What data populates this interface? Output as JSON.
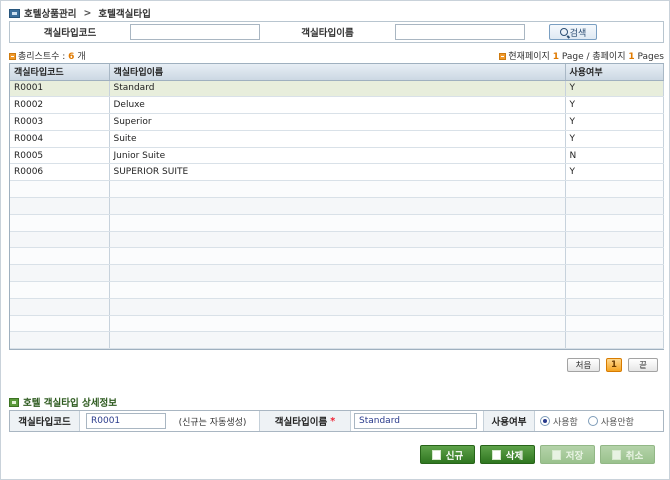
{
  "breadcrumb": {
    "parent": "호텔상품관리",
    "separator": ">",
    "current": "호텔객실타입"
  },
  "search": {
    "code_label": "객실타입코드",
    "code_value": "",
    "name_label": "객실타입이름",
    "name_value": "",
    "button_label": "검색"
  },
  "summary": {
    "total_label": "총리스트수 :",
    "total_count": "6",
    "total_unit": "개",
    "page_prefix": "현재페이지",
    "current_page": "1",
    "page_mid": "Page / 총페이지",
    "total_pages": "1",
    "page_suffix": "Pages"
  },
  "table": {
    "columns": [
      "객실타입코드",
      "객실타입이름",
      "사용여부"
    ],
    "rows": [
      [
        "R0001",
        "Standard",
        "Y"
      ],
      [
        "R0002",
        "Deluxe",
        "Y"
      ],
      [
        "R0003",
        "Superior",
        "Y"
      ],
      [
        "R0004",
        "Suite",
        "Y"
      ],
      [
        "R0005",
        "Junior Suite",
        "N"
      ],
      [
        "R0006",
        "SUPERIOR SUITE",
        "Y"
      ],
      [
        "",
        "",
        ""
      ],
      [
        "",
        "",
        ""
      ],
      [
        "",
        "",
        ""
      ],
      [
        "",
        "",
        ""
      ],
      [
        "",
        "",
        ""
      ],
      [
        "",
        "",
        ""
      ],
      [
        "",
        "",
        ""
      ],
      [
        "",
        "",
        ""
      ],
      [
        "",
        "",
        ""
      ],
      [
        "",
        "",
        ""
      ]
    ],
    "selected_row": 0
  },
  "pager": {
    "first": "처음",
    "current": "1",
    "last": "끝"
  },
  "detail": {
    "title": "호텔 객실타입 상세정보",
    "code_label": "객실타입코드",
    "code_value": "R0001",
    "code_note": "(신규는 자동생성)",
    "name_label": "객실타입이름",
    "name_required": "*",
    "name_value": "Standard",
    "use_label": "사용여부",
    "use_yes": "사용함",
    "use_no": "사용안함",
    "use_selected": "사용함"
  },
  "actions": {
    "new": "신규",
    "delete": "삭제",
    "save": "저장",
    "cancel": "취소"
  },
  "colors": {
    "accent_green": "#2f7620",
    "selected_row": "#e8eedc",
    "count_orange": "#e07a00"
  }
}
